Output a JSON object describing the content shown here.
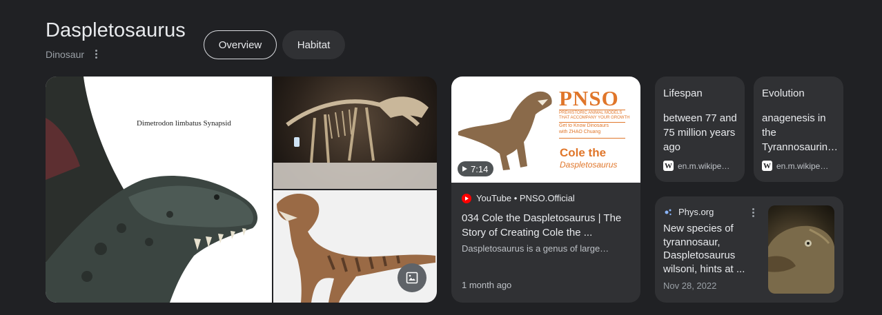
{
  "entity": {
    "title": "Daspletosaurus",
    "subtitle": "Dinosaur"
  },
  "tabs": [
    {
      "label": "Overview",
      "selected": true
    },
    {
      "label": "Habitat",
      "selected": false
    }
  ],
  "images": {
    "main_caption": "Dimetrodon limbatus Synapsid"
  },
  "video": {
    "duration": "7:14",
    "channel_line": "YouTube • PNSO.Official",
    "title": "034 Cole the Daspletosaurus | The Story of Creating Cole the ...",
    "description": "Daspletosaurus is a genus of large…",
    "age": "1 month ago",
    "thumb": {
      "logo": "PNSO",
      "tag1": "PREHISTORIC ANIMAL MODELS",
      "tag2": "THAT ACCOMPANY YOUR GROWTH",
      "tag3": "Get to Know Dinosaurs",
      "tag4": "with ZHAO Chuang",
      "name1": "Cole the",
      "name2": "Daspletosaurus"
    }
  },
  "facts": [
    {
      "label": "Lifespan",
      "value": "between 77 and 75 million years ago",
      "source": "en.m.wikipe…"
    },
    {
      "label": "Evolution",
      "value": "anagenesis in the Tyrannosaurin…",
      "source": "en.m.wikipe…"
    }
  ],
  "news": {
    "source": "Phys.org",
    "title": "New species of tyrannosaur, Daspletosaurus wilsoni, hints at ...",
    "date": "Nov 28, 2022"
  },
  "colors": {
    "background": "#202124",
    "card": "#303134",
    "accent_orange": "#e0762a",
    "youtube_red": "#ff0000"
  }
}
